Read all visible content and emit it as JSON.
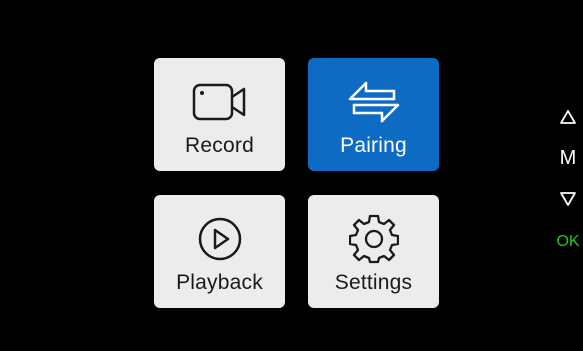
{
  "menu": {
    "items": [
      {
        "label": "Record",
        "icon": "video-camera-icon",
        "selected": false
      },
      {
        "label": "Pairing",
        "icon": "swap-arrows-icon",
        "selected": true
      },
      {
        "label": "Playback",
        "icon": "play-circle-icon",
        "selected": false
      },
      {
        "label": "Settings",
        "icon": "gear-icon",
        "selected": false
      }
    ]
  },
  "side_buttons": {
    "up": "△",
    "m": "M",
    "down": "▽",
    "ok": "OK"
  },
  "colors": {
    "background": "#000000",
    "tile": "#ececec",
    "selected_tile": "#0d6bc4",
    "ok_text": "#26c71f"
  }
}
